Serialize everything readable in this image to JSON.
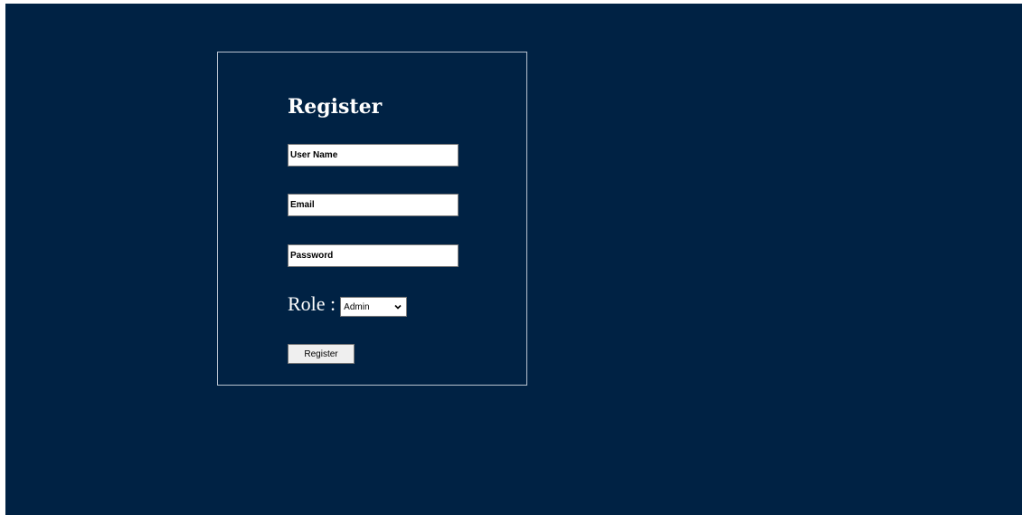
{
  "form": {
    "title": "Register",
    "username_placeholder": "User Name",
    "email_placeholder": "Email",
    "password_placeholder": "Password",
    "role_label": "Role :",
    "role_selected": "Admin",
    "submit_label": "Register"
  },
  "colors": {
    "background": "#002244",
    "border": "#b8c2cf",
    "text": "#ffffff"
  },
  "icons": {
    "select_arrow": "chevron-down-icon"
  }
}
